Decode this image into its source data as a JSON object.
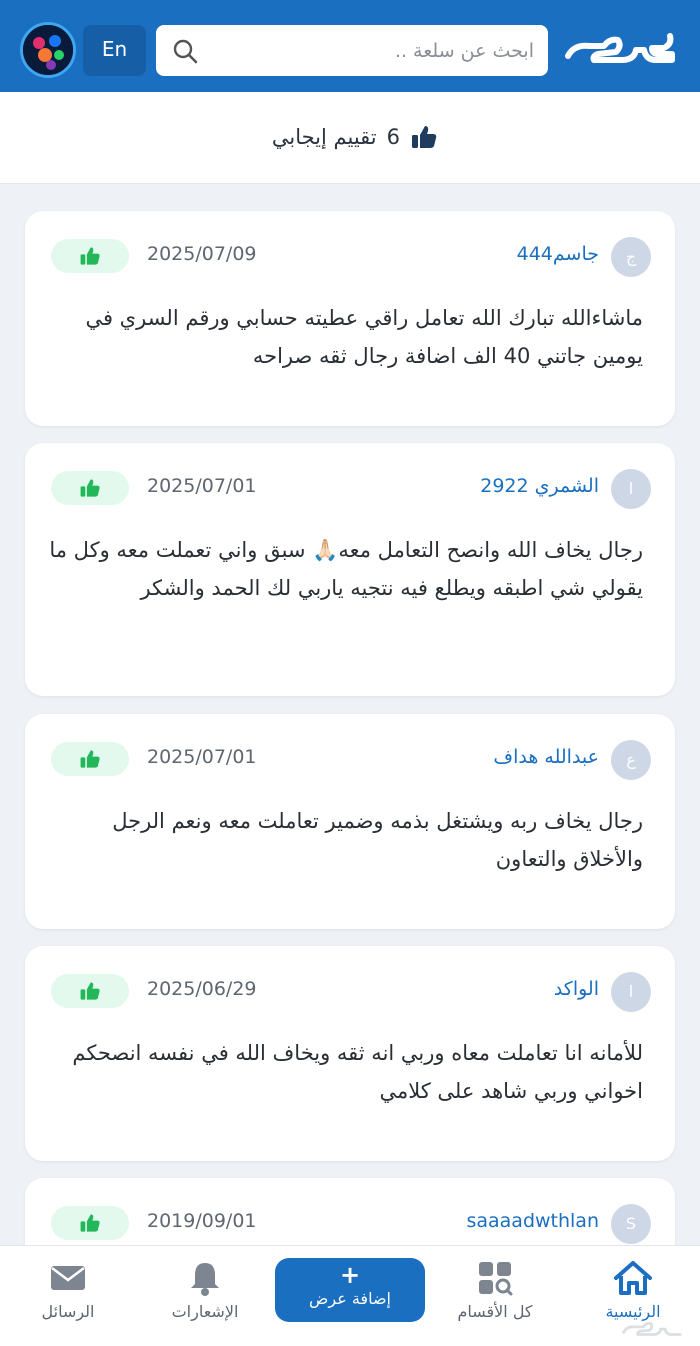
{
  "header": {
    "brand": "حراج",
    "search_placeholder": "ابحث عن سلعة ..",
    "lang_label": "En"
  },
  "summary": {
    "positive_count": "6",
    "label": "تقييم إيجابي"
  },
  "reviews": [
    {
      "initial": "ج",
      "name": "جاسم444",
      "date": "2025/07/09",
      "text": "ماشاءالله تبارك الله تعامل راقي عطيته حسابي ورقم السري في يومين جاتني 40 الف اضافة رجال ثقه صراحه"
    },
    {
      "initial": "ا",
      "name": "الشمري 2922",
      "date": "2025/07/01",
      "text": "رجال يخاف الله وانصح التعامل معه🙏🏻 سبق واني تعملت معه وكل ما يقولي شي اطبقه ويطلع فيه نتجيه ياربي لك الحمد والشكر"
    },
    {
      "initial": "ع",
      "name": "عبدالله هداف",
      "date": "2025/07/01",
      "text": "رجال يخاف ربه ويشتغل بذمه وضمير تعاملت معه ونعم الرجل والأخلاق والتعاون"
    },
    {
      "initial": "ا",
      "name": "الواكد",
      "date": "2025/06/29",
      "text": "للأمانه انا تعاملت معاه وربي انه ثقه ويخاف الله في نفسه انصحكم اخواني وربي شاهد على كلامي"
    },
    {
      "initial": "S",
      "name": "saaaadwthlan",
      "date": "2019/09/01",
      "text": ""
    }
  ],
  "bottom_nav": {
    "home": "الرئيسية",
    "categories": "كل الأقسام",
    "add_offer": "إضافة عرض",
    "add_plus": "+",
    "notifications": "الإشعارات",
    "messages": "الرسائل"
  },
  "colors": {
    "brand_blue": "#1a6fc0",
    "positive_green": "#22b85a",
    "badge_bg": "#e3f9ee"
  }
}
